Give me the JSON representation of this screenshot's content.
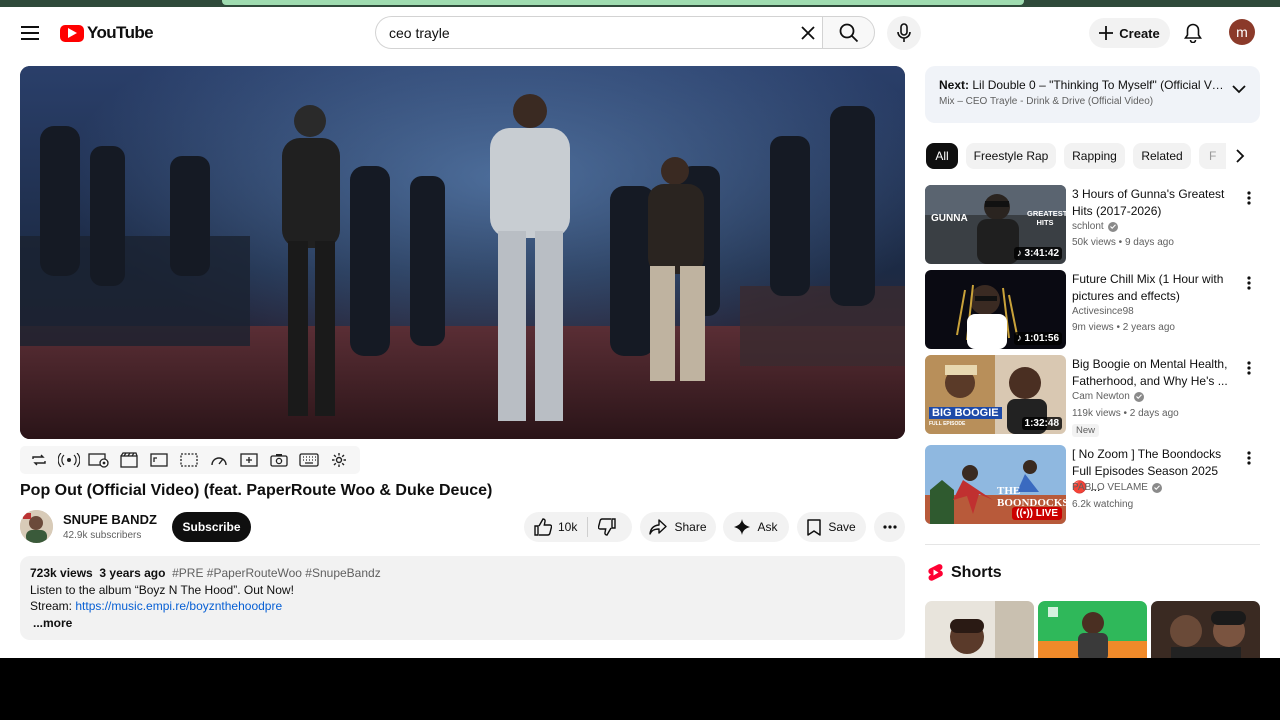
{
  "brand": {
    "logo_text": "YouTube"
  },
  "search": {
    "value": "ceo trayle"
  },
  "masthead": {
    "create_label": "Create",
    "avatar_letter": "m"
  },
  "video": {
    "title": "Pop Out (Official Video) (feat. PaperRoute Woo & Duke Deuce)",
    "channel": "SNUPE BANDZ",
    "subscribers": "42.9k subscribers",
    "subscribe_label": "Subscribe",
    "likes": "10k",
    "share_label": "Share",
    "ask_label": "Ask",
    "save_label": "Save"
  },
  "description": {
    "views": "723k views",
    "age": "3 years ago",
    "tags": "#PRE #PaperRouteWoo #SnupeBandz",
    "line1": "Listen to the album “Boyz N The Hood”. Out Now!",
    "stream_label": "Stream:",
    "stream_link": "https://music.empi.re/boyznthehoodpre",
    "more": "...more"
  },
  "up_next": {
    "prefix": "Next:",
    "title": "Lil Double 0 – \"Thinking To Myself\" (Official Vi...",
    "mix": "Mix – CEO Trayle - Drink & Drive (Official Video)"
  },
  "chips": [
    "All",
    "Freestyle Rap",
    "Rapping",
    "Related",
    "F"
  ],
  "recommendations": [
    {
      "title": "3 Hours of Gunna's Greatest Hits (2017-2026)",
      "channel": "schlont",
      "meta": "50k views • 9 days ago",
      "duration": "3:41:42",
      "thumb_text": "GUNNA",
      "thumb_text2": "GREATEST HITS"
    },
    {
      "title": "Future Chill Mix (1 Hour with pictures and effects)",
      "channel": "Activesince98",
      "meta": "9m views • 2 years ago",
      "duration": "1:01:56"
    },
    {
      "title": "Big Boogie on Mental Health, Fatherhood, and Why He's ...",
      "channel": "Cam Newton",
      "meta": "119k views • 2 days ago",
      "badge": "New",
      "duration": "1:32:48",
      "thumb_text": "BIG BOOGIE",
      "thumb_text2": "FULL EPISODE"
    },
    {
      "title": "[ No Zoom ] The Boondocks Full Episodes Season 2025 🔴 ...",
      "channel": "PABLO VELAME",
      "meta": "6.2k watching",
      "live": "LIVE",
      "thumb_text": "THE BOONDOCKS"
    }
  ],
  "shorts": {
    "heading": "Shorts"
  }
}
